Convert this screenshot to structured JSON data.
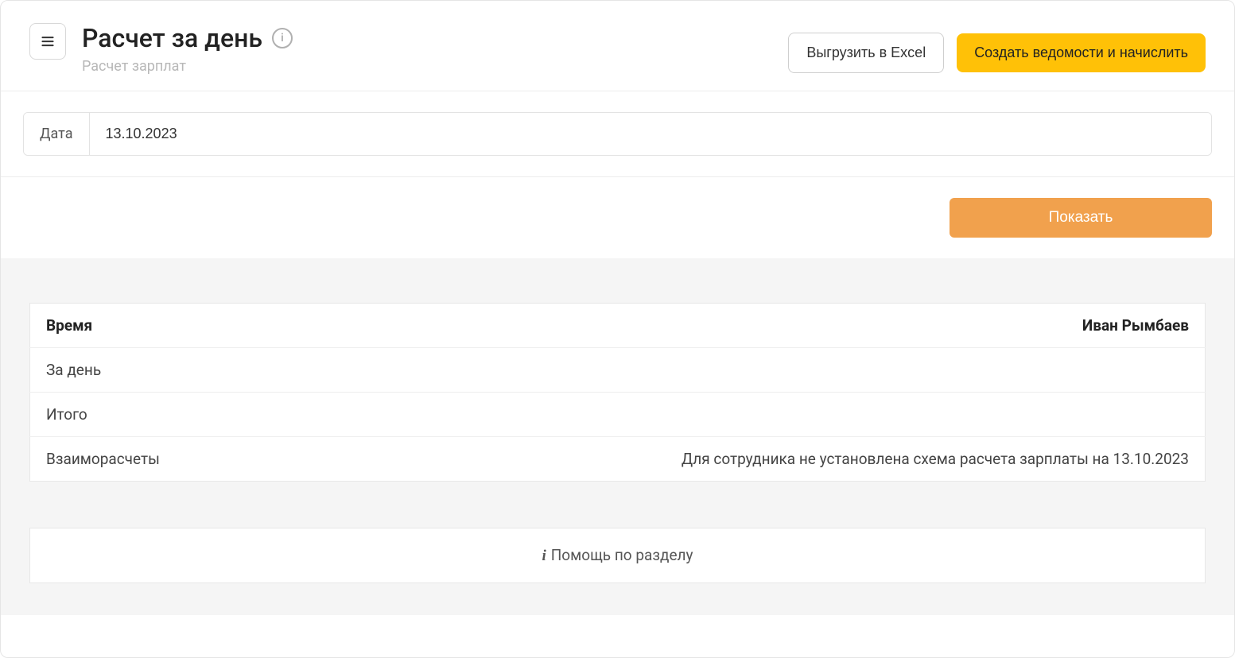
{
  "header": {
    "title": "Расчет за день",
    "subtitle": "Расчет зарплат",
    "info_icon_glyph": "i",
    "export_label": "Выгрузить в Excel",
    "create_label": "Создать ведомости и начислить"
  },
  "filter": {
    "date_label": "Дата",
    "date_value": "13.10.2023"
  },
  "actions": {
    "show_label": "Показать"
  },
  "table": {
    "col_time": "Время",
    "col_person": "Иван Рымбаев",
    "rows": {
      "per_day": "За день",
      "total": "Итого",
      "mutual": "Взаиморасчеты",
      "mutual_note": "Для сотрудника не установлена схема расчета зарплаты на 13.10.2023"
    }
  },
  "help": {
    "label": "Помощь по разделу"
  }
}
